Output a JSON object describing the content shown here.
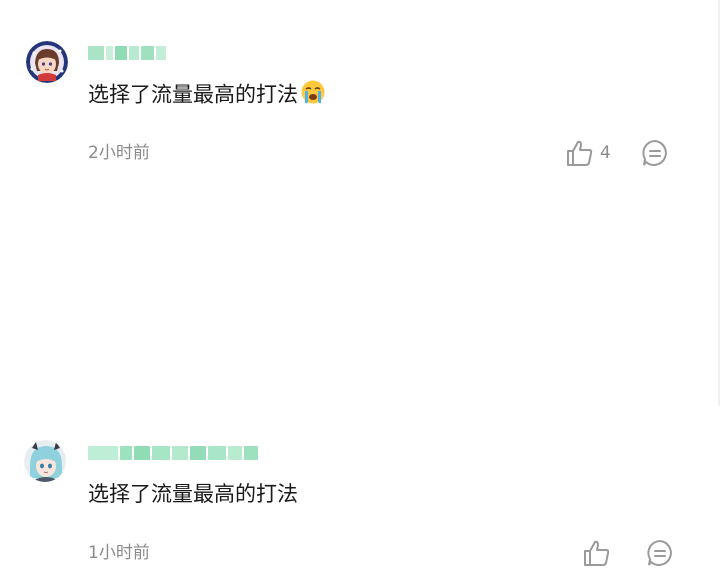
{
  "comments": [
    {
      "username_blurred": true,
      "text": "选择了流量最高的打法",
      "emoji": "crying-face",
      "time": "2小时前",
      "likes": "4"
    },
    {
      "username_blurred": true,
      "text": "选择了流量最高的打法",
      "time": "1小时前"
    }
  ],
  "colors": {
    "text": "#1a1a1a",
    "meta": "#8a8a8a",
    "username_blur": "#7fd4a8"
  }
}
